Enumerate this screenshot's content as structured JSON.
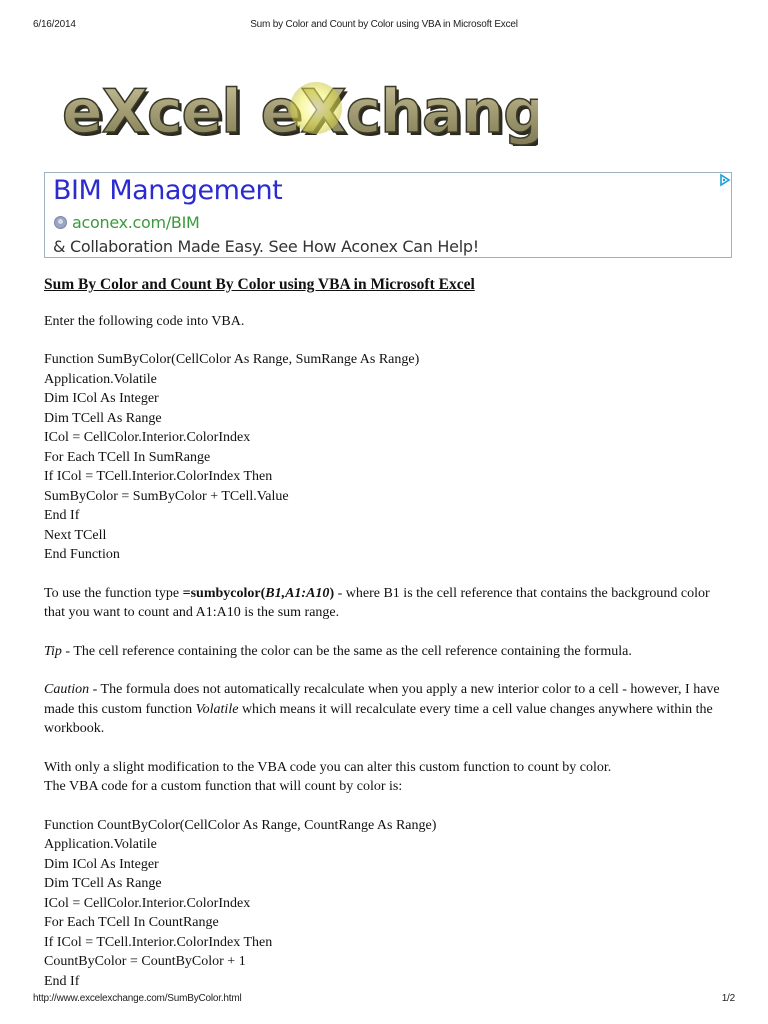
{
  "print_header": {
    "date": "6/16/2014",
    "title": "Sum by Color and Count by Color using VBA in Microsoft Excel"
  },
  "logo": {
    "text": "eXcel eXchange",
    "colors": {
      "stone": "#a9a27a",
      "highlight": "#e8e84a",
      "outline": "#3a3a2a"
    }
  },
  "ad": {
    "title": "BIM Management",
    "url_icon": "globe-icon",
    "url": "aconex.com/BIM",
    "description": "& Collaboration Made Easy. See How Aconex Can Help!",
    "choices_icon": "adchoices-icon",
    "colors": {
      "title": "#2b2bd0",
      "url": "#3b9a3b",
      "border": "#9fb0c4"
    }
  },
  "article": {
    "heading": "Sum By Color and Count By Color using VBA in Microsoft Excel",
    "intro": "Enter the following code into VBA.",
    "sum_code": [
      "Function SumByColor(CellColor As Range, SumRange As Range)",
      "Application.Volatile",
      "Dim ICol As Integer",
      "Dim TCell As Range",
      "ICol = CellColor.Interior.ColorIndex",
      "For Each TCell In SumRange",
      "If ICol = TCell.Interior.ColorIndex Then",
      "SumByColor = SumByColor + TCell.Value",
      "End If",
      "Next TCell",
      "End Function"
    ],
    "usage": {
      "prefix": "To use the function type ",
      "formula_bold": "=sumbycolor(",
      "formula_italic": "B1,A1:A10",
      "formula_close": ")",
      "suffix": " - where B1 is the cell reference that contains the background color that you want to count and A1:A10 is the sum range."
    },
    "tip": {
      "label": "Tip",
      "text": " - The cell reference containing the color can be the same as the cell reference containing the formula."
    },
    "caution": {
      "label": "Caution",
      "text_before": " - The formula does not automatically recalculate when you apply a new interior color to a cell - however, I have made this custom function ",
      "emphasis": "Volatile",
      "text_after": " which means it will recalculate every time a cell value changes anywhere within the workbook."
    },
    "modification_line1": "With only a slight modification to the VBA code you can alter this custom function to count by color.",
    "modification_line2": "The VBA code for a custom function that will count by color is:",
    "count_code": [
      "Function CountByColor(CellColor As Range, CountRange As Range)",
      "Application.Volatile",
      "Dim ICol As Integer",
      "Dim TCell As Range",
      "ICol = CellColor.Interior.ColorIndex",
      "For Each TCell In CountRange",
      "If ICol = TCell.Interior.ColorIndex Then",
      "CountByColor = CountByColor + 1",
      "End If"
    ]
  },
  "print_footer": {
    "url": "http://www.excelexchange.com/SumByColor.html",
    "page": "1/2"
  }
}
